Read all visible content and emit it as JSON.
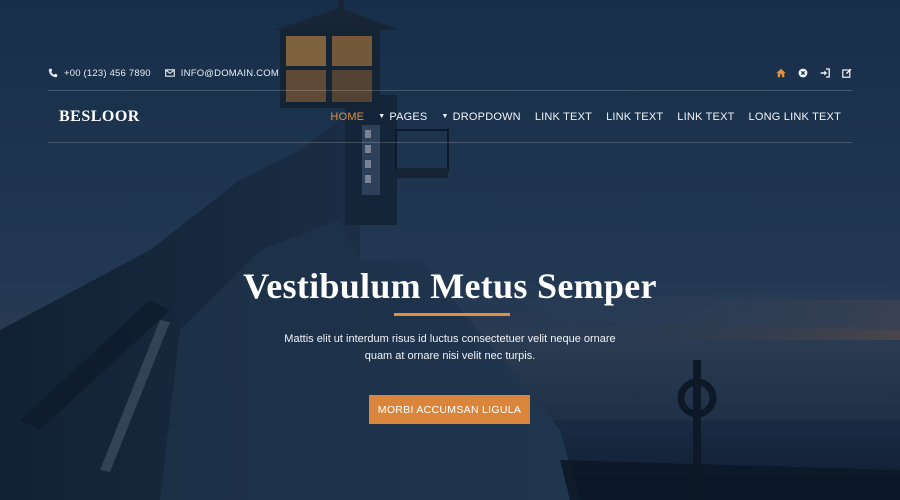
{
  "topbar": {
    "phone": "+00 (123) 456 7890",
    "email": "INFO@DOMAIN.COM",
    "icons": [
      "home-icon",
      "close-icon",
      "sign-in-icon",
      "edit-icon"
    ]
  },
  "nav": {
    "brand": "BESLOOR",
    "items": [
      {
        "label": "HOME",
        "active": true,
        "dropdown": false
      },
      {
        "label": "PAGES",
        "active": false,
        "dropdown": true
      },
      {
        "label": "DROPDOWN",
        "active": false,
        "dropdown": true
      },
      {
        "label": "LINK TEXT",
        "active": false,
        "dropdown": false
      },
      {
        "label": "LINK TEXT",
        "active": false,
        "dropdown": false
      },
      {
        "label": "LINK TEXT",
        "active": false,
        "dropdown": false
      },
      {
        "label": "LONG LINK TEXT",
        "active": false,
        "dropdown": false
      }
    ]
  },
  "hero": {
    "title": "Vestibulum Metus Semper",
    "text": "Mattis elit ut interdum risus id luctus consectetuer velit neque ornare quam at ornare nisi velit nec turpis.",
    "cta": "MORBI ACCUMSAN LIGULA"
  },
  "colors": {
    "accent": "#e09040",
    "button": "#d9863c",
    "background": "#12243a"
  }
}
